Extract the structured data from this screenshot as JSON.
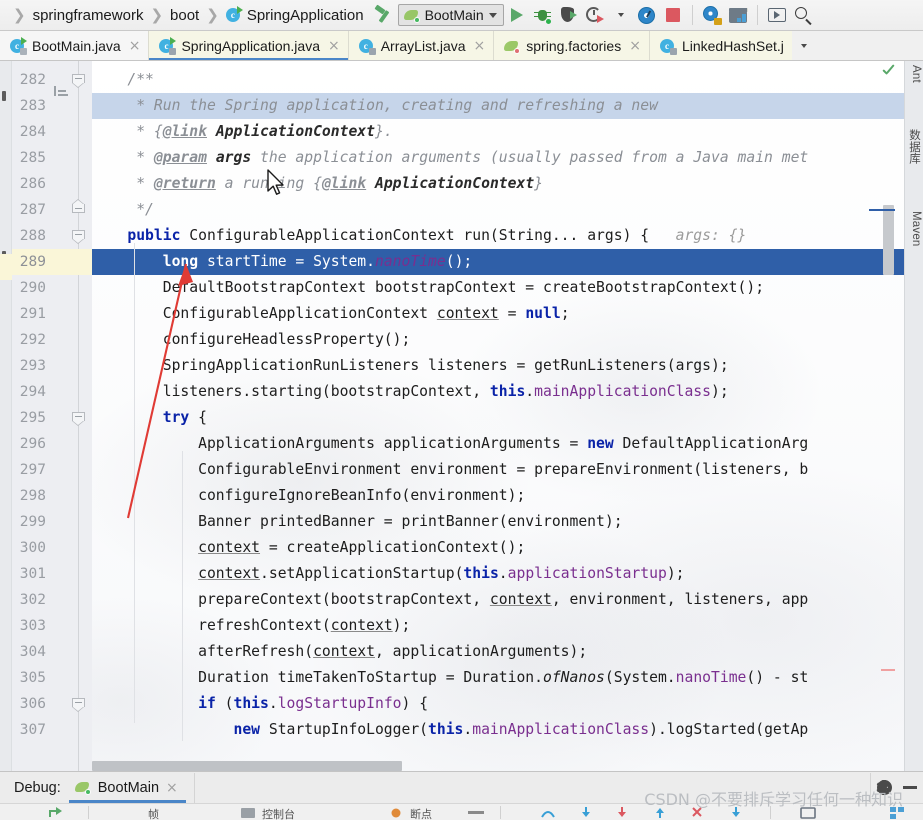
{
  "window": {
    "breadcrumb": {
      "items": [
        {
          "label": "springframework",
          "icon": ""
        },
        {
          "label": "boot",
          "icon": ""
        },
        {
          "label": "SpringApplication",
          "icon": "java-class-icon"
        }
      ],
      "separator": "❯"
    },
    "toolbar": {
      "build_icon": "hammer-icon",
      "run_config": {
        "name": "BootMain",
        "icon": "spring-boot-icon",
        "caret": "chevron-down-icon"
      },
      "buttons": [
        {
          "name": "run-button",
          "icon": "play-icon"
        },
        {
          "name": "debug-button",
          "icon": "debug-bug-icon"
        },
        {
          "name": "run-with-coverage-button",
          "icon": "coverage-shield-icon"
        },
        {
          "name": "profile-button",
          "icon": "clock-run-icon"
        },
        {
          "name": "profile-dropdown",
          "icon": "chevron-down-icon"
        },
        {
          "name": "attach-profiler-button",
          "icon": "gauge-icon"
        },
        {
          "name": "stop-button",
          "icon": "stop-square-icon"
        },
        {
          "name": "attach-process-button",
          "icon": "gauge-plug-icon"
        },
        {
          "name": "project-structure-button",
          "icon": "folder-modules-icon"
        },
        {
          "name": "terminal-button",
          "icon": "screen-play-icon"
        },
        {
          "name": "search-everywhere-button",
          "icon": "search-icon"
        }
      ]
    }
  },
  "tabs": {
    "items": [
      {
        "label": "BootMain.java",
        "icon": "java-runnable-class-icon",
        "selected": false,
        "closable": true
      },
      {
        "label": "SpringApplication.java",
        "icon": "java-class-icon",
        "selected": true,
        "closable": true
      },
      {
        "label": "ArrayList.java",
        "icon": "java-library-class-icon",
        "selected": false,
        "closable": true
      },
      {
        "label": "spring.factories",
        "icon": "spring-factories-icon",
        "selected": false,
        "closable": true
      },
      {
        "label": "LinkedHashSet.j",
        "icon": "java-library-class-icon",
        "selected": false,
        "closable": false
      }
    ],
    "overflow_caret": "chevron-down-icon",
    "close_glyph": "×"
  },
  "editor": {
    "first_partial_line": "281",
    "current_line": 289,
    "doc_highlight_line": 283,
    "lines": [
      {
        "n": "282",
        "indent": 0,
        "fold": "start",
        "text": "    /**"
      },
      {
        "n": "283",
        "indent": 0,
        "text": "     * Run the Spring application, creating and refreshing a new"
      },
      {
        "n": "284",
        "indent": 0,
        "text": "     * {@link ApplicationContext}."
      },
      {
        "n": "285",
        "indent": 0,
        "text": "     * @param args the application arguments (usually passed from a Java main met"
      },
      {
        "n": "286",
        "indent": 0,
        "text": "     * @return a running {@link ApplicationContext}"
      },
      {
        "n": "287",
        "indent": 0,
        "fold": "end",
        "text": "     */"
      },
      {
        "n": "288",
        "indent": 0,
        "fold": "start",
        "text": "    public ConfigurableApplicationContext run(String... args) {   args: {}"
      },
      {
        "n": "289",
        "indent": 1,
        "text": "        long startTime = System.nanoTime();"
      },
      {
        "n": "290",
        "indent": 1,
        "text": "        DefaultBootstrapContext bootstrapContext = createBootstrapContext();"
      },
      {
        "n": "291",
        "indent": 1,
        "text": "        ConfigurableApplicationContext context = null;"
      },
      {
        "n": "292",
        "indent": 1,
        "text": "        configureHeadlessProperty();"
      },
      {
        "n": "293",
        "indent": 1,
        "text": "        SpringApplicationRunListeners listeners = getRunListeners(args);"
      },
      {
        "n": "294",
        "indent": 1,
        "text": "        listeners.starting(bootstrapContext, this.mainApplicationClass);"
      },
      {
        "n": "295",
        "indent": 1,
        "fold": "start",
        "text": "        try {"
      },
      {
        "n": "296",
        "indent": 2,
        "text": "            ApplicationArguments applicationArguments = new DefaultApplicationArg"
      },
      {
        "n": "297",
        "indent": 2,
        "text": "            ConfigurableEnvironment environment = prepareEnvironment(listeners, b"
      },
      {
        "n": "298",
        "indent": 2,
        "text": "            configureIgnoreBeanInfo(environment);"
      },
      {
        "n": "299",
        "indent": 2,
        "text": "            Banner printedBanner = printBanner(environment);"
      },
      {
        "n": "300",
        "indent": 2,
        "text": "            context = createApplicationContext();"
      },
      {
        "n": "301",
        "indent": 2,
        "text": "            context.setApplicationStartup(this.applicationStartup);"
      },
      {
        "n": "302",
        "indent": 2,
        "text": "            prepareContext(bootstrapContext, context, environment, listeners, app"
      },
      {
        "n": "303",
        "indent": 2,
        "text": "            refreshContext(context);"
      },
      {
        "n": "304",
        "indent": 2,
        "text": "            afterRefresh(context, applicationArguments);"
      },
      {
        "n": "305",
        "indent": 2,
        "text": "            Duration timeTakenToStartup = Duration.ofNanos(System.nanoTime() - st"
      },
      {
        "n": "306",
        "indent": 2,
        "fold": "start",
        "text": "            if (this.logStartupInfo) {"
      },
      {
        "n": "307",
        "indent": 3,
        "text": "                new StartupInfoLogger(this.mainApplicationClass).logStarted(getAp"
      }
    ],
    "inlay_hint": "args: {}",
    "inspection_status": "ok-check-icon"
  },
  "right_stripe": {
    "labels": [
      "Ant",
      "数据库",
      "Maven"
    ]
  },
  "debug_panel": {
    "title": "Debug:",
    "tab_label": "BootMain",
    "tab_icon": "spring-boot-icon",
    "close_glyph": "×",
    "settings_icon": "gear-icon",
    "minimize_icon": "minimize-icon"
  },
  "watermark": "CSDN @不要排斥学习任何一种知识",
  "colors": {
    "accent_blue": "#4a86c8",
    "selection_blue": "#2f5fa8",
    "doc_highlight": "#c6d5ea",
    "current_line_gutter": "#faf6d8",
    "keyword": "#0a23a8",
    "field": "#7a2f8f",
    "comment": "#8b8f95",
    "green_run": "#59a869",
    "red_stop": "#db5860",
    "annotation_red": "#e03b35"
  }
}
